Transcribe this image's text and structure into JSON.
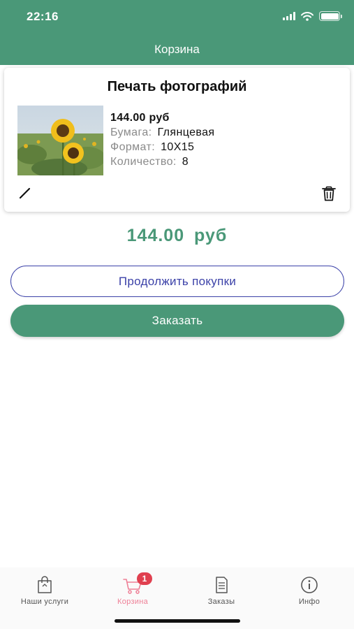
{
  "status_bar": {
    "time": "22:16"
  },
  "nav": {
    "title": "Корзина"
  },
  "cart_item": {
    "title": "Печать фотографий",
    "price": "144.00 руб",
    "paper_label": "Бумага:",
    "paper_value": "Глянцевая",
    "format_label": "Формат:",
    "format_value": "10X15",
    "quantity_label": "Количество:",
    "quantity_value": "8",
    "edit_icon": "pencil-icon",
    "delete_icon": "trash-icon"
  },
  "total": {
    "amount": "144.00 руб"
  },
  "buttons": {
    "continue_label": "Продолжить покупки",
    "order_label": "Заказать"
  },
  "tabbar": {
    "items": [
      {
        "label": "Наши услуги",
        "icon": "shopping-bag-icon",
        "active": false
      },
      {
        "label": "Корзина",
        "icon": "cart-icon",
        "active": true,
        "badge": "1"
      },
      {
        "label": "Заказы",
        "icon": "document-icon",
        "active": false
      },
      {
        "label": "Инфо",
        "icon": "info-icon",
        "active": false
      }
    ]
  },
  "colors": {
    "primary_green": "#4a9878",
    "outline_blue": "#3b41a8",
    "active_tab_pink": "#ee7f96",
    "badge_red": "#e03f4f"
  }
}
